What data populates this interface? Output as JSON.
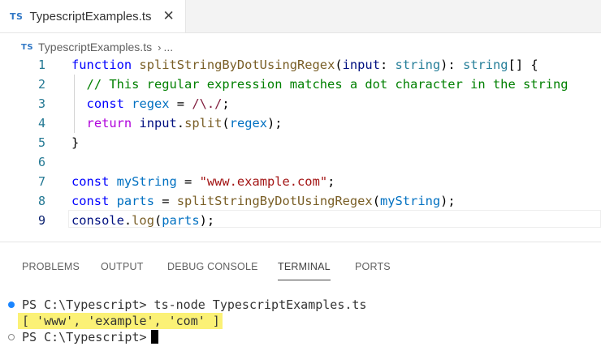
{
  "tab": {
    "badge": "TS",
    "title": "TypescriptExamples.ts",
    "close_icon": "close-icon"
  },
  "breadcrumb": {
    "badge": "TS",
    "file": "TypescriptExamples.ts",
    "separator": "›",
    "ellipsis": "..."
  },
  "editor": {
    "line_numbers": [
      "1",
      "2",
      "3",
      "4",
      "5",
      "6",
      "7",
      "8",
      "9"
    ],
    "lines": [
      "function splitStringByDotUsingRegex(input: string): string[] {",
      "  // This regular expression matches a dot character in the string",
      "  const regex = /\\./;",
      "  return input.split(regex);",
      "}",
      "",
      "const myString = \"www.example.com\";",
      "const parts = splitStringByDotUsingRegex(myString);",
      "console.log(parts);"
    ],
    "tokens": {
      "l1": [
        "function",
        " ",
        "splitStringByDotUsingRegex",
        "(",
        "input",
        ": ",
        "string",
        "): ",
        "string",
        "[] {"
      ],
      "l2": [
        "// This regular expression matches a dot character in the string"
      ],
      "l3": [
        "const",
        " ",
        "regex",
        " = ",
        "/\\./",
        ";"
      ],
      "l4": [
        "return",
        " ",
        "input",
        ".",
        "split",
        "(",
        "regex",
        ");"
      ],
      "l5": [
        "}"
      ],
      "l7": [
        "const",
        " ",
        "myString",
        " = ",
        "\"www.example.com\"",
        ";"
      ],
      "l8": [
        "const",
        " ",
        "parts",
        " = ",
        "splitStringByDotUsingRegex",
        "(",
        "myString",
        ");"
      ],
      "l9": [
        "console",
        ".",
        "log",
        "(",
        "parts",
        ");"
      ]
    }
  },
  "panel": {
    "tabs": [
      "PROBLEMS",
      "OUTPUT",
      "DEBUG CONSOLE",
      "TERMINAL",
      "PORTS"
    ],
    "active_tab": "TERMINAL"
  },
  "terminal": {
    "lines": [
      "PS C:\\Typescript> ts-node TypescriptExamples.ts",
      "[ 'www', 'example', 'com' ]",
      "PS C:\\Typescript>"
    ]
  },
  "colors": {
    "keyword": "#0000ff",
    "control": "#af00db",
    "function": "#795e26",
    "variable": "#001080",
    "type": "#267f99",
    "string": "#a31515",
    "regex": "#811f3f",
    "comment": "#008000",
    "line_number": "#237893",
    "highlight": "#fbf176",
    "decoration_success": "#1a85ff"
  }
}
